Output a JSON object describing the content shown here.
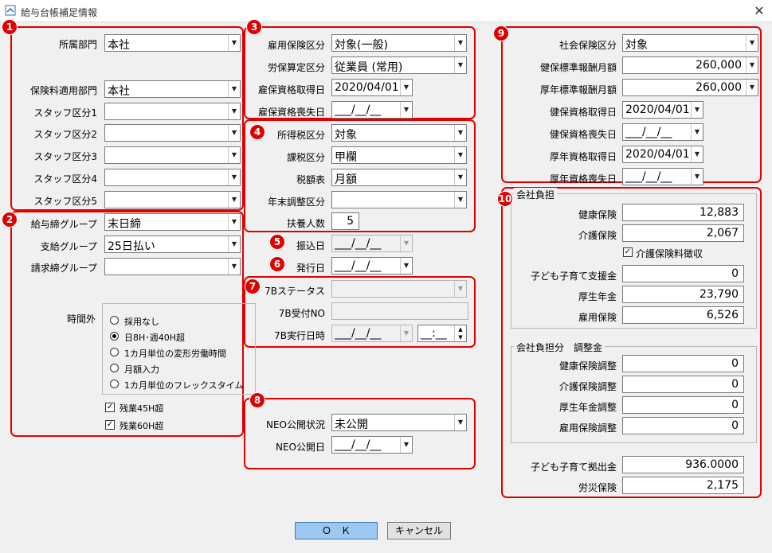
{
  "window": {
    "title": "給与台帳補足情報",
    "close": "✕"
  },
  "badges": [
    "1",
    "2",
    "3",
    "4",
    "5",
    "6",
    "7",
    "8",
    "9",
    "10"
  ],
  "s1": {
    "dept": {
      "label": "所属部門",
      "value": "本社"
    },
    "ins_dept": {
      "label": "保険料適用部門",
      "value": "本社"
    },
    "staff": [
      {
        "label": "スタッフ区分1",
        "value": ""
      },
      {
        "label": "スタッフ区分2",
        "value": ""
      },
      {
        "label": "スタッフ区分3",
        "value": ""
      },
      {
        "label": "スタッフ区分4",
        "value": ""
      },
      {
        "label": "スタッフ区分5",
        "value": ""
      }
    ]
  },
  "s2": {
    "close_group": {
      "label": "給与締グループ",
      "value": "末日締"
    },
    "pay_group": {
      "label": "支給グループ",
      "value": "25日払い"
    },
    "bill_group": {
      "label": "請求締グループ",
      "value": ""
    },
    "overtime": {
      "label": "時間外",
      "options": [
        "採用なし",
        "日8H･週40H超",
        "1カ月単位の変形労働時間",
        "月額入力",
        "1カ月単位のフレックスタイム"
      ],
      "selected": 1
    },
    "ot45": {
      "label": "残業45H超",
      "checked": true
    },
    "ot60": {
      "label": "残業60H超",
      "checked": true
    }
  },
  "s3": {
    "emp_ins": {
      "label": "雇用保険区分",
      "value": "対象(一般)"
    },
    "labor_calc": {
      "label": "労保算定区分",
      "value": "従業員 (常用)"
    },
    "acquire": {
      "label": "雇保資格取得日",
      "value": "2020/04/01"
    },
    "lose": {
      "label": "雇保資格喪失日",
      "value": "___/__/__"
    }
  },
  "s4": {
    "income_tax": {
      "label": "所得税区分",
      "value": "対象"
    },
    "tax_class": {
      "label": "課税区分",
      "value": "甲欄"
    },
    "tax_table": {
      "label": "税額表",
      "value": "月額"
    },
    "year_end": {
      "label": "年末調整区分",
      "value": ""
    },
    "dependents": {
      "label": "扶養人数",
      "value": "5"
    }
  },
  "s5": {
    "label": "振込日",
    "value": "___/__/__"
  },
  "s6": {
    "label": "発行日",
    "value": "___/__/__"
  },
  "s7": {
    "status": {
      "label": "7Bステータス",
      "value": ""
    },
    "recv_no": {
      "label": "7B受付NO",
      "value": ""
    },
    "exec_dt": {
      "label": "7B実行日時",
      "date": "___/__/__",
      "time": "__:__"
    }
  },
  "s8": {
    "neo_status": {
      "label": "NEO公開状況",
      "value": "未公開"
    },
    "neo_date": {
      "label": "NEO公開日",
      "value": "___/__/__"
    }
  },
  "s9": {
    "social": {
      "label": "社会保険区分",
      "value": "対象"
    },
    "health_std": {
      "label": "健保標準報酬月額",
      "value": "260,000"
    },
    "pension_std": {
      "label": "厚年標準報酬月額",
      "value": "260,000"
    },
    "health_acq": {
      "label": "健保資格取得日",
      "value": "2020/04/01"
    },
    "health_lose": {
      "label": "健保資格喪失日",
      "value": "___/__/__"
    },
    "pension_acq": {
      "label": "厚年資格取得日",
      "value": "2020/04/01"
    },
    "pension_lose": {
      "label": "厚年資格喪失日",
      "value": "___/__/__"
    }
  },
  "s10": {
    "group1": "会社負担",
    "health": {
      "label": "健康保険",
      "value": "12,883"
    },
    "care": {
      "label": "介護保険",
      "value": "2,067"
    },
    "care_chk": {
      "label": "介護保険料徴収",
      "checked": true
    },
    "child": {
      "label": "子ども子育て支援金",
      "value": "0"
    },
    "pension": {
      "label": "厚生年金",
      "value": "23,790"
    },
    "employ": {
      "label": "雇用保険",
      "value": "6,526"
    },
    "group2": "会社負担分　調整金",
    "adj_health": {
      "label": "健康保険調整",
      "value": "0"
    },
    "adj_care": {
      "label": "介護保険調整",
      "value": "0"
    },
    "adj_pension": {
      "label": "厚生年金調整",
      "value": "0"
    },
    "adj_employ": {
      "label": "雇用保険調整",
      "value": "0"
    },
    "child_contrib": {
      "label": "子ども子育て拠出金",
      "value": "936.0000"
    },
    "workers": {
      "label": "労災保険",
      "value": "2,175"
    }
  },
  "buttons": {
    "ok": "Ｏ　Ｋ",
    "cancel": "キャンセル"
  },
  "glyphs": {
    "arrow": "▼",
    "check": "✓",
    "up": "▲",
    "down": "▼"
  },
  "colors": {
    "accent": "#e00000",
    "ok_button": "#9bc8f0"
  }
}
